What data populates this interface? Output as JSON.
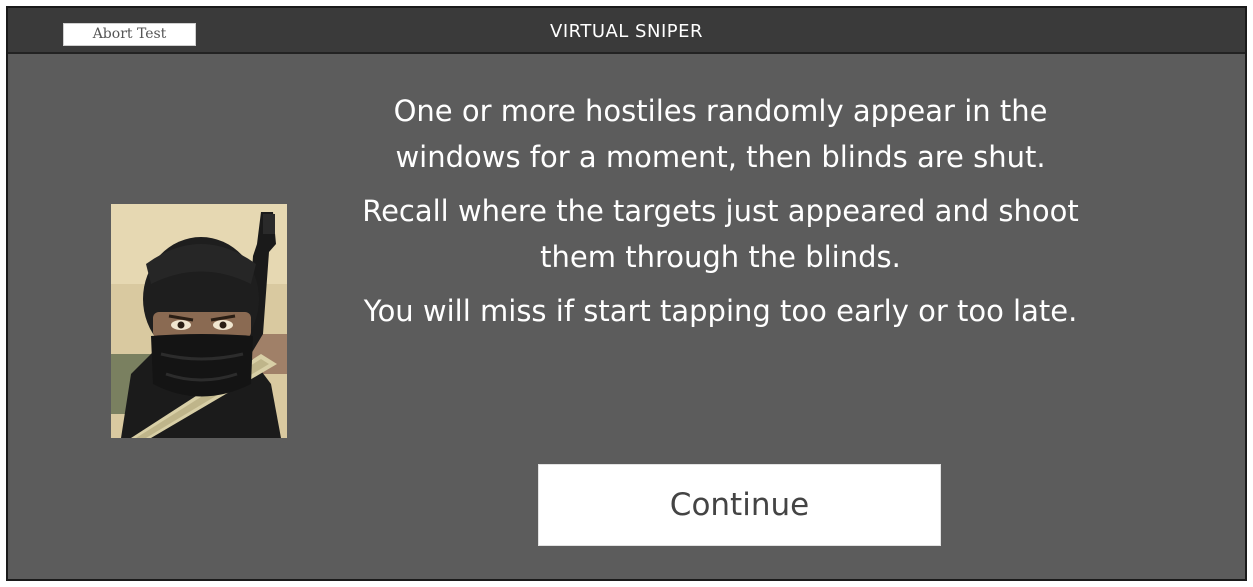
{
  "header": {
    "title": "VIRTUAL SNIPER",
    "abort_label": "Abort Test"
  },
  "main": {
    "portrait_icon": "masked-hostile-with-rifle",
    "instructions": [
      "One or more hostiles randomly appear in the windows for a moment, then blinds are shut.",
      "Recall where the targets just appeared and shoot them through the blinds.",
      "You will miss if start tapping too early or too late."
    ],
    "continue_label": "Continue"
  },
  "colors": {
    "background": "#5c5c5c",
    "title_bar": "#3a3a3a",
    "text": "#ffffff",
    "button": "#ffffff"
  }
}
